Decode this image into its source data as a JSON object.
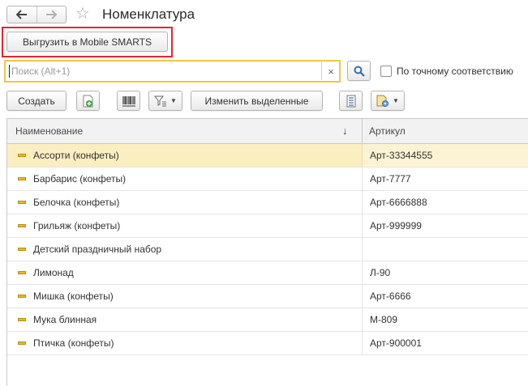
{
  "window": {
    "title": "Номенклатура"
  },
  "icons": {
    "back": "back-arrow-icon",
    "forward": "forward-arrow-icon",
    "favorite": "star-icon",
    "search": "search-icon",
    "clear": "close-icon"
  },
  "toolbar_top": {
    "export_label": "Выгрузить в Mobile SMARTS"
  },
  "search": {
    "placeholder": "Поиск (Alt+1)",
    "value": "",
    "clear_glyph": "×",
    "exact_match_label": "По точному соответствию",
    "exact_match_checked": false
  },
  "toolbar": {
    "create_label": "Создать",
    "edit_selected_label": "Изменить выделенные"
  },
  "table": {
    "columns": {
      "name": "Наименование",
      "article": "Артикул",
      "sort_glyph": "↓"
    },
    "rows": [
      {
        "name": "Ассорти (конфеты)",
        "article": "Арт-33344555",
        "selected": true
      },
      {
        "name": "Барбарис (конфеты)",
        "article": "Арт-7777",
        "selected": false
      },
      {
        "name": "Белочка (конфеты)",
        "article": "Арт-6666888",
        "selected": false
      },
      {
        "name": "Грильяж (конфеты)",
        "article": "Арт-999999",
        "selected": false
      },
      {
        "name": "Детский праздничный набор",
        "article": "",
        "selected": false
      },
      {
        "name": "Лимонад",
        "article": "Л-90",
        "selected": false
      },
      {
        "name": "Мишка (конфеты)",
        "article": "Арт-6666",
        "selected": false
      },
      {
        "name": "Мука блинная",
        "article": "М-809",
        "selected": false
      },
      {
        "name": "Птичка (конфеты)",
        "article": "Арт-900001",
        "selected": false
      }
    ]
  },
  "colors": {
    "highlight_frame": "#e6262f",
    "search_focus": "#f1c64a",
    "selected_row": "#fbeec0",
    "item_indicator": "#e8b92a"
  }
}
